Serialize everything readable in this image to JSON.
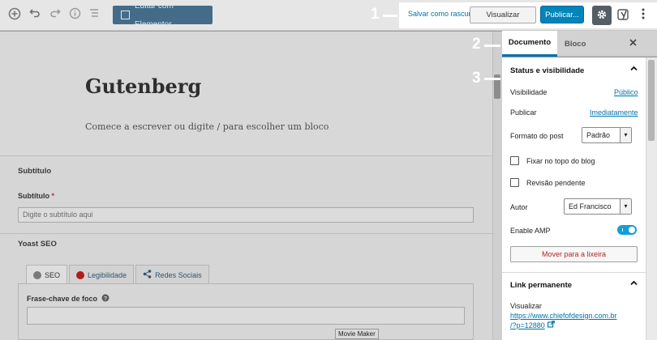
{
  "toolbar": {
    "icons": [
      "add-block-icon",
      "undo-icon",
      "redo-icon",
      "info-icon",
      "outline-icon"
    ],
    "elementor_label": "Editar com Elementor",
    "save_draft": "Salvar como rascunho",
    "preview": "Visualizar",
    "publish": "Publicar...",
    "settings_icon": "gear-icon",
    "yoast_icon": "yoast-icon",
    "more_icon": "more-vertical-icon"
  },
  "editor": {
    "title": "Gutenberg",
    "placeholder": "Comece a escrever ou digite / para escolher um bloco"
  },
  "subtitle_box": {
    "heading": "Subtítulo",
    "field_label": "Subtítulo",
    "required_mark": "*",
    "field_placeholder": "Digite o subtítulo aqui"
  },
  "yoast_box": {
    "heading": "Yoast SEO",
    "tabs": [
      {
        "label": "SEO",
        "dot_color": "#7a7a7a"
      },
      {
        "label": "Legibilidade",
        "dot_color": "#b51a1a"
      },
      {
        "label": "Redes Sociais",
        "icon": "share-icon"
      }
    ],
    "focus_label": "Frase-chave de foco",
    "help_icon": "help-icon"
  },
  "tooltip": "Movie Maker",
  "sidebar": {
    "tabs": [
      {
        "label": "Documento",
        "active": true
      },
      {
        "label": "Bloco",
        "active": false
      }
    ],
    "close_icon": "close-icon",
    "status_section": {
      "title": "Status e visibilidade",
      "visibility_label": "Visibilidade",
      "visibility_value": "Público",
      "publish_label": "Publicar",
      "publish_value": "Imediatamente",
      "format_label": "Formato do post",
      "format_value": "Padrão",
      "sticky_label": "Fixar no topo do blog",
      "pending_label": "Revisão pendente",
      "author_label": "Autor",
      "author_value": "Ed Francisco",
      "amp_label": "Enable AMP",
      "amp_enabled": true,
      "trash_label": "Mover para a lixeira"
    },
    "permalink_section": {
      "title": "Link permanente",
      "view_label": "Visualizar",
      "url_line1": "https://www.chiefofdesign.com.br",
      "url_line2": "/?p=12880"
    }
  },
  "callouts": [
    "1",
    "2",
    "3"
  ],
  "colors": {
    "accent": "#0085ba",
    "link": "#0073aa",
    "trash": "#b3261e",
    "toggle": "#11a0d2"
  }
}
